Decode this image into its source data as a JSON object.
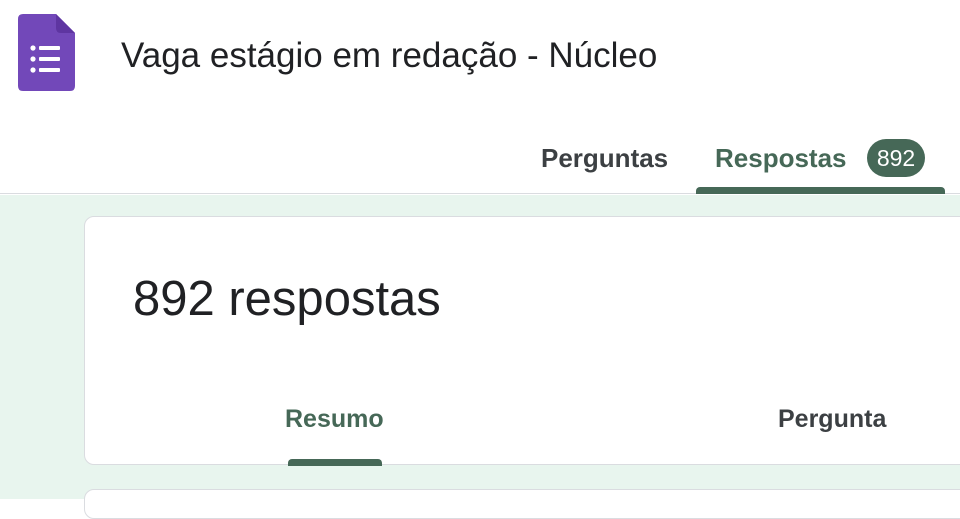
{
  "app": {
    "icon": "google-forms-icon",
    "brand_color": "#7248b9"
  },
  "header": {
    "title": "Vaga estágio em redação - Núcleo",
    "tabs": [
      {
        "label": "Perguntas",
        "active": false
      },
      {
        "label": "Respostas",
        "active": true,
        "badge": "892"
      }
    ]
  },
  "summary": {
    "title": "892 respostas",
    "subtabs": [
      {
        "label": "Resumo",
        "active": true
      },
      {
        "label": "Pergunta",
        "active": false
      }
    ]
  },
  "colors": {
    "accent": "#466857",
    "background": "#e8f5ee"
  }
}
